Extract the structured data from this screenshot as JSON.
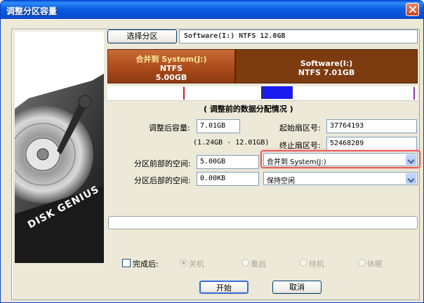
{
  "window": {
    "title": "调整分区容量"
  },
  "disk_panel": {
    "brand": "DISK GENIUS"
  },
  "select_partition_button": "选择分区",
  "partition_info": "Software(I:) NTFS 12.0GB",
  "partitions": [
    {
      "name": "合并到 System(J:)",
      "fs": "NTFS",
      "size": "5.00GB",
      "color": "#a8491a"
    },
    {
      "name": "Software(I:)",
      "fs": "NTFS 7.01GB",
      "color": "#7d3b10"
    }
  ],
  "distribution_caption": "( 调整前的数据分配情况 )",
  "distribution_markers": {
    "red_marker_color": "#d11b1b",
    "blue_block_color": "#1b1bf0",
    "purple_marker_color": "#8a3aa8"
  },
  "form": {
    "new_size_label": "调整后容量:",
    "new_size_value": "7.01GB",
    "range_hint": "(1.24GB - 12.01GB)",
    "start_sector_label": "起始扇区号:",
    "start_sector_value": "37764193",
    "end_sector_label": "终止扇区号:",
    "end_sector_value": "52468289",
    "front_space_label": "分区前部的空间:",
    "front_space_value": "5.00GB",
    "front_space_action": "合并到 System(J:)",
    "rear_space_label": "分区后部的空间:",
    "rear_space_value": "0.00KB",
    "rear_space_action": "保持空闲",
    "highlight_color": "#e85b5b"
  },
  "after_complete": {
    "label": "完成后:",
    "options": [
      "关机",
      "重启",
      "待机",
      "休眠"
    ],
    "checked": false
  },
  "buttons": {
    "start": "开始",
    "cancel": "取消"
  }
}
